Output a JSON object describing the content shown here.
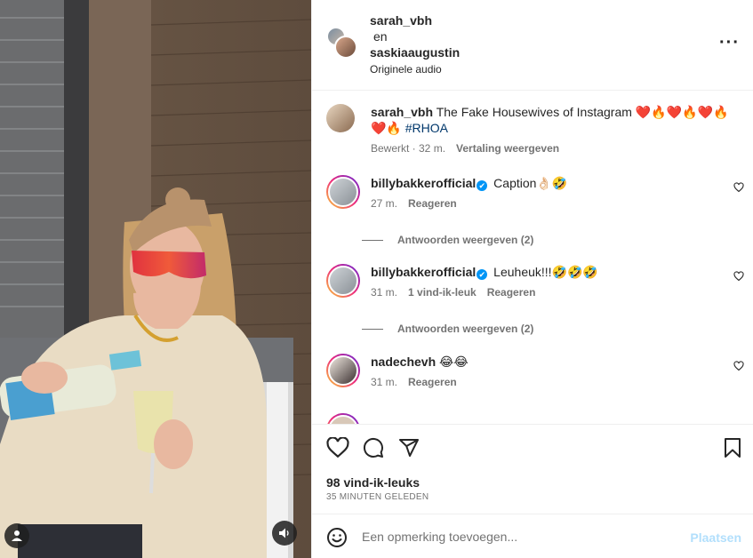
{
  "header": {
    "user_primary": "sarah_vbh",
    "joiner": "en",
    "user_secondary": "saskiaaugustin",
    "audio": "Originele audio"
  },
  "caption": {
    "username": "sarah_vbh",
    "text": "The Fake Housewives of Instagram ❤️🔥❤️🔥❤️🔥❤️🔥",
    "hashtag": "#RHOA",
    "edited": "Bewerkt · 32 m.",
    "translate": "Vertaling weergeven"
  },
  "comments": [
    {
      "username": "billybakkerofficial",
      "verified": "✔",
      "text": "Caption👌🏻🤣",
      "time": "27 m.",
      "likes": "",
      "reply": "Reageren",
      "view_replies": "Antwoorden weergeven (2)"
    },
    {
      "username": "billybakkerofficial",
      "verified": "✔",
      "text": "Leuheuk!!!🤣🤣🤣",
      "time": "31 m.",
      "likes": "1 vind-ik-leuk",
      "reply": "Reageren",
      "view_replies": "Antwoorden weergeven (2)"
    },
    {
      "username": "nadechevh",
      "text": "😂😂",
      "time": "31 m.",
      "reply": "Reageren"
    }
  ],
  "stats": {
    "likes": "98 vind-ik-leuks",
    "posted": "35 MINUTEN GELEDEN"
  },
  "composer": {
    "placeholder": "Een opmerking toevoegen...",
    "post_label": "Plaatsen"
  },
  "colors": {
    "link": "#00376b",
    "muted": "#737373",
    "post_disabled": "#b2dffc",
    "verified": "#0095f6"
  },
  "icons": [
    "more-icon",
    "heart-icon",
    "comment-icon",
    "share-icon",
    "bookmark-icon",
    "emoji-icon",
    "user-tag-icon",
    "speaker-icon"
  ]
}
